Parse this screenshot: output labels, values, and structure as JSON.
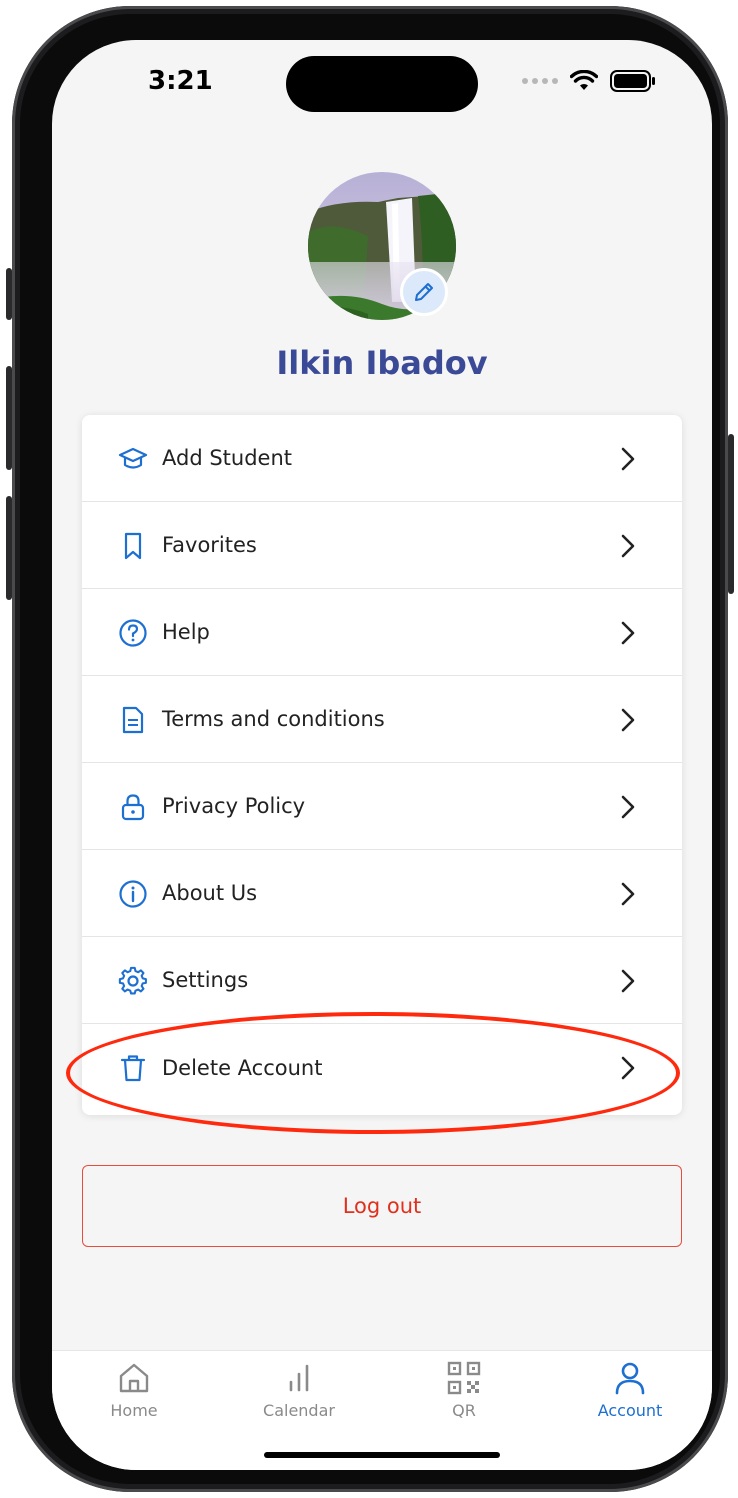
{
  "status_bar": {
    "time": "3:21"
  },
  "profile": {
    "name": "Ilkin Ibadov"
  },
  "menu": [
    {
      "label": "Add Student",
      "icon": "graduation-cap-icon"
    },
    {
      "label": "Favorites",
      "icon": "bookmark-icon"
    },
    {
      "label": "Help",
      "icon": "help-circle-icon"
    },
    {
      "label": "Terms and conditions",
      "icon": "document-icon"
    },
    {
      "label": "Privacy Policy",
      "icon": "lock-icon"
    },
    {
      "label": "About Us",
      "icon": "info-circle-icon"
    },
    {
      "label": "Settings",
      "icon": "gear-icon"
    },
    {
      "label": "Delete Account",
      "icon": "trash-icon"
    }
  ],
  "logout_label": "Log out",
  "tabs": [
    {
      "label": "Home",
      "icon": "home-icon"
    },
    {
      "label": "Calendar",
      "icon": "bar-chart-icon"
    },
    {
      "label": "QR",
      "icon": "qr-code-icon"
    },
    {
      "label": "Account",
      "icon": "user-icon",
      "active": true
    }
  ],
  "colors": {
    "accent": "#1d6fd1",
    "name": "#3b4a96",
    "danger": "#e0311e",
    "annotation": "#ff2a0e"
  }
}
